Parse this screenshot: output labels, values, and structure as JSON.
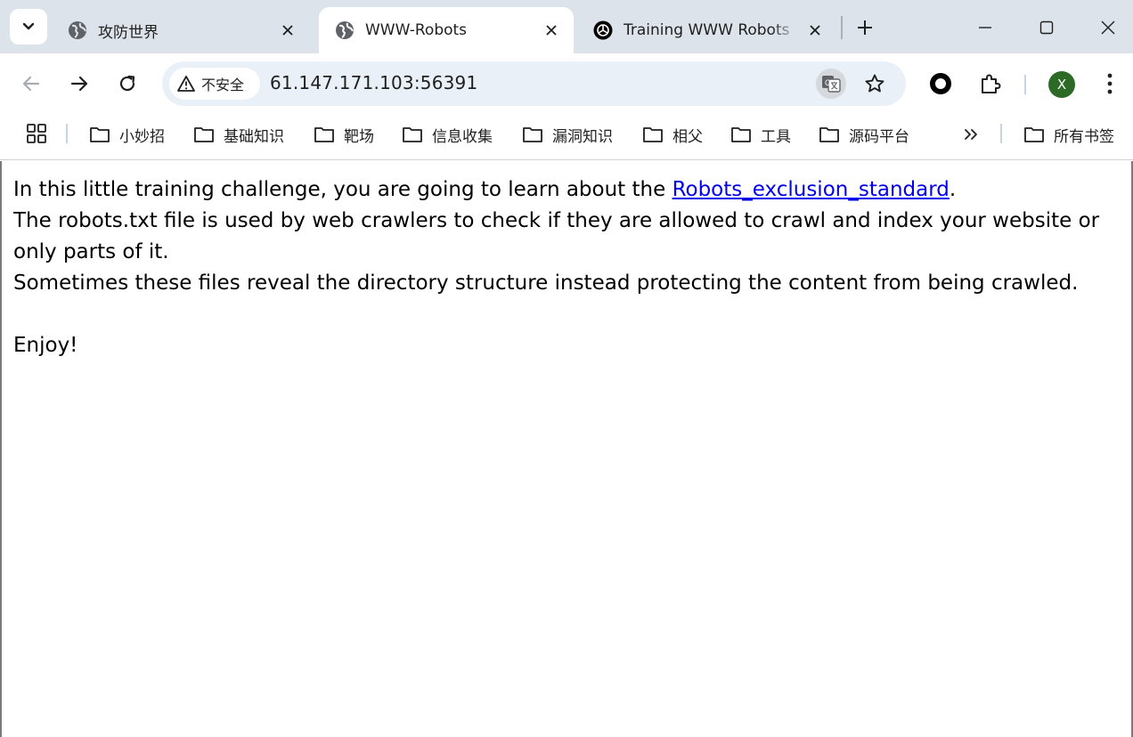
{
  "tabs": [
    {
      "title": "攻防世界",
      "favicon": "globe-icon",
      "active": false
    },
    {
      "title": "WWW-Robots",
      "favicon": "globe-icon",
      "active": true
    },
    {
      "title": "Training WWW Robots",
      "favicon": "openai-icon",
      "active": false
    }
  ],
  "toolbar": {
    "security_label": "不安全",
    "url": "61.147.171.103:56391",
    "profile_initial": "X"
  },
  "bookmarks": [
    {
      "label": "小妙招"
    },
    {
      "label": "基础知识"
    },
    {
      "label": "靶场"
    },
    {
      "label": "信息收集"
    },
    {
      "label": "漏洞知识"
    },
    {
      "label": "相父"
    },
    {
      "label": "工具"
    },
    {
      "label": "源码平台"
    }
  ],
  "all_bookmarks_label": "所有书签",
  "page": {
    "line1_before": "In this little training challenge, you are going to learn about the ",
    "link_text": "Robots_exclusion_standard",
    "line1_after": ".",
    "line2": "The robots.txt file is used by web crawlers to check if they are allowed to crawl and index your website or only parts of it.",
    "line3": "Sometimes these files reveal the directory structure instead protecting the content from being crawled.",
    "line4": "Enjoy!"
  },
  "colors": {
    "tabstrip_bg": "#dde3ea",
    "omnibox_bg": "#eaf0f7",
    "link": "#0000ee",
    "profile_bg": "#2d6a25"
  }
}
